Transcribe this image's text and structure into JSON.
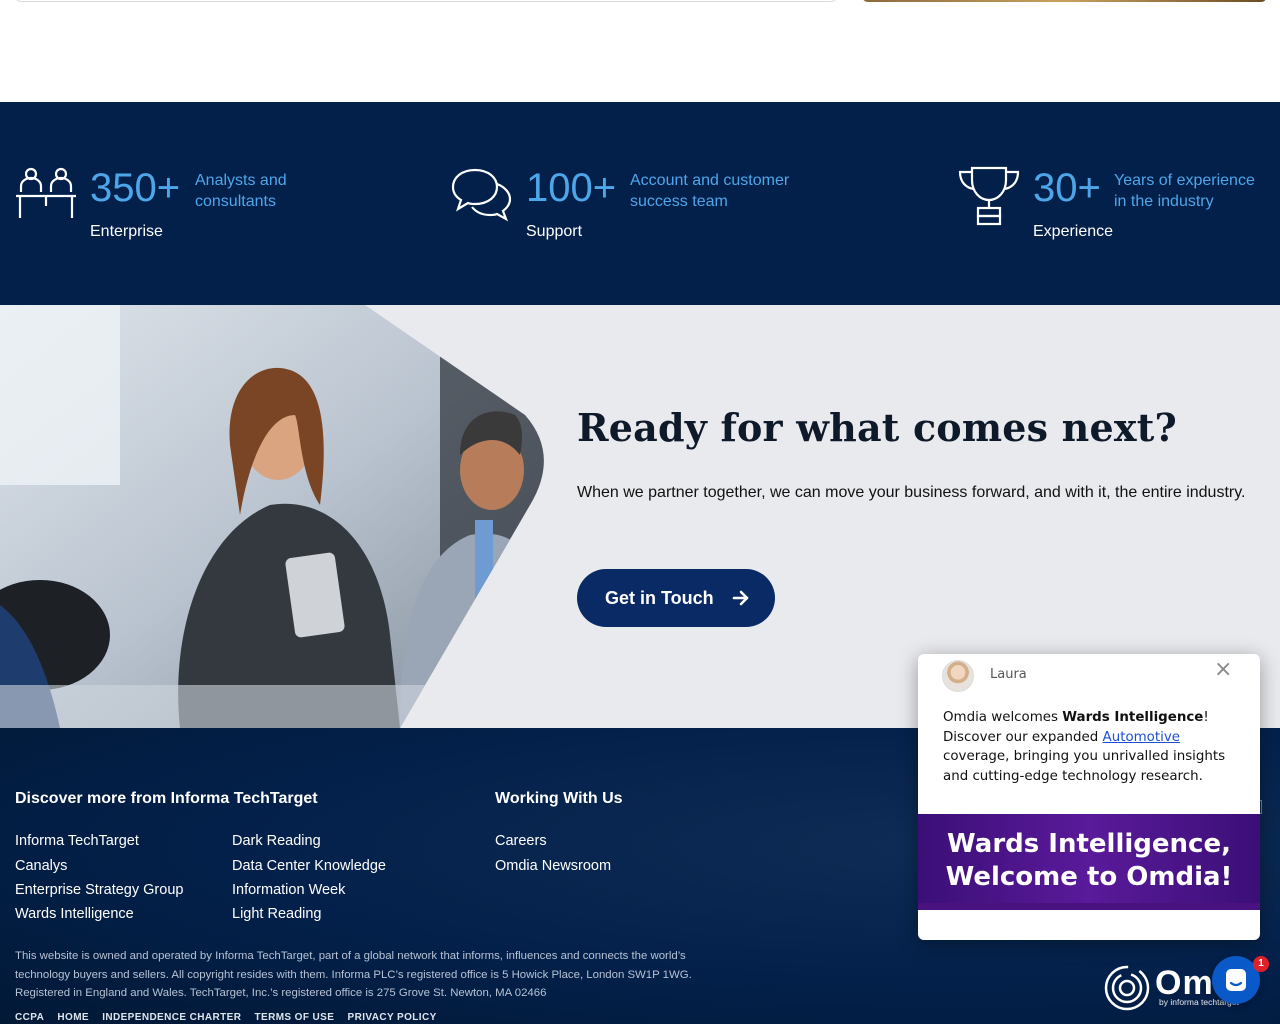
{
  "stats": [
    {
      "icon": "team-desk-icon",
      "number": "350+",
      "desc": "Analysts and consultants",
      "desc_line1": "Analysts and",
      "desc_line2": "consultants",
      "label": "Enterprise"
    },
    {
      "icon": "chat-bubbles-icon",
      "number": "100+",
      "desc": "Account and customer success team",
      "desc_line1": "Account and customer",
      "desc_line2": "success team",
      "label": "Support"
    },
    {
      "icon": "trophy-icon",
      "number": "30+",
      "desc": "Years of experience in the industry",
      "desc_line1": "Years of experience",
      "desc_line2": "in the industry",
      "label": "Experience"
    }
  ],
  "hero": {
    "title": "Ready for what comes next?",
    "text": "When we partner together, we can move your business forward, and with it, the entire industry.",
    "button_label": "Get in Touch"
  },
  "footer": {
    "discover_heading": "Discover more from Informa TechTarget",
    "discover_col1": [
      "Informa TechTarget",
      "Canalys",
      "Enterprise Strategy Group",
      "Wards Intelligence"
    ],
    "discover_col2": [
      "Dark Reading",
      "Data Center Knowledge",
      "Information Week",
      "Light Reading"
    ],
    "working_heading": "Working With Us",
    "working_links": [
      "Careers",
      "Omdia Newsroom"
    ],
    "legal": "This website is owned and operated by Informa TechTarget, part of a global network that informs, influences and connects the world’s technology buyers and sellers. All copyright resides with them. Informa PLC’s registered office is 5 Howick Place, London SW1P 1WG. Registered in England and Wales. TechTarget, Inc.’s registered office is 275 Grove St. Newton, MA 02466",
    "bottom_links": [
      "CCPA",
      "HOME",
      "INDEPENDENCE CHARTER",
      "TERMS OF USE",
      "PRIVACY POLICY"
    ],
    "logo_text": "Om",
    "logo_sub": "by informa techtarget"
  },
  "chat": {
    "agent_name": "Laura",
    "msg_part1": "Omdia welcomes ",
    "msg_bold": "Wards Intelligence",
    "msg_part2": "! Discover our expanded ",
    "msg_link": "Automotive",
    "msg_part3": " coverage, bringing you unrivalled insights and cutting-edge technology research.",
    "banner_line1": "Wards Intelligence,",
    "banner_line2": "Welcome to Omdia!",
    "close_label": "×"
  },
  "launcher": {
    "badge_count": "1"
  },
  "colors": {
    "navy": "#03204a",
    "accent_blue": "#4ea6ea",
    "button": "#0a2a66",
    "banner_purple": "#4a127f"
  }
}
